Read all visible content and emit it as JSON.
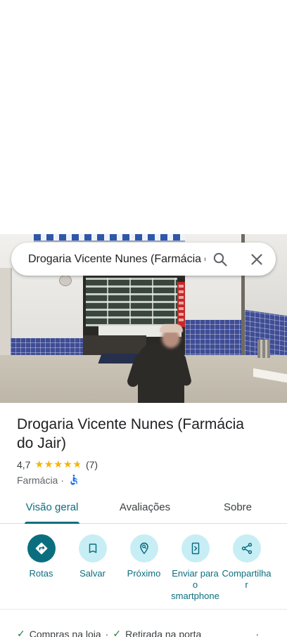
{
  "search": {
    "query": "Drogaria Vicente Nunes (Farmácia d",
    "search_icon": "search-icon",
    "close_icon": "close-icon"
  },
  "place": {
    "name": "Drogaria Vicente Nunes (Farmácia do Jair)",
    "rating": "4,7",
    "rating_value": 4.7,
    "rating_max": 5,
    "review_count": "(7)",
    "category": "Farmácia",
    "separator": "·",
    "accessibility_icon": "wheelchair-icon"
  },
  "tabs": [
    {
      "label": "Visão geral",
      "active": true
    },
    {
      "label": "Avaliações",
      "active": false
    },
    {
      "label": "Sobre",
      "active": false
    }
  ],
  "actions": [
    {
      "label": "Rotas",
      "icon": "directions-icon",
      "primary": true
    },
    {
      "label": "Salvar",
      "icon": "bookmark-icon",
      "primary": false
    },
    {
      "label": "Próximo",
      "icon": "nearby-icon",
      "primary": false
    },
    {
      "label": "Enviar para o smartphone",
      "icon": "send-to-phone-icon",
      "primary": false
    },
    {
      "label": "Compartilhar",
      "icon": "share-icon",
      "primary": false
    }
  ],
  "attributes": [
    {
      "check": "✓",
      "label": "Compras na loja"
    },
    {
      "check": "✓",
      "label": "Retirada na porta"
    }
  ],
  "attribute_separator": "·",
  "colors": {
    "accent": "#0b6e7f",
    "accent_light": "#c8eef5",
    "star": "#f7b500",
    "check": "#188038",
    "accessibility": "#1a73e8"
  }
}
